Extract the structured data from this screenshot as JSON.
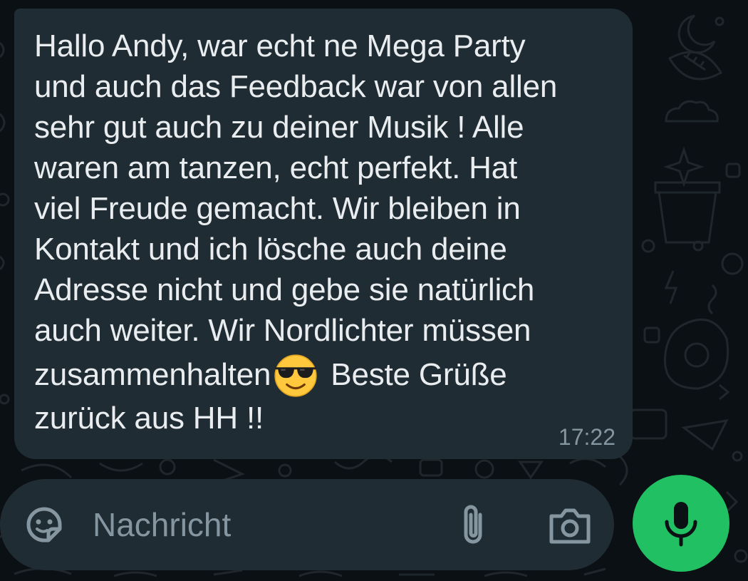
{
  "message": {
    "text_before_emoji": "Hallo Andy, war echt ne Mega Party\nund auch das Feedback war von allen\nsehr gut auch zu deiner Musik ! Alle\nwaren am tanzen, echt perfekt. Hat\nviel Freude gemacht. Wir bleiben in\nKontakt und ich lösche auch deine\nAdresse nicht und gebe sie natürlich\nauch weiter. Wir Nordlichter müssen\nzusammenhalten",
    "emoji": "smiling-face-with-sunglasses",
    "text_after_emoji": " Beste Grüße\nzurück aus HH !!",
    "time": "17:22"
  },
  "composer": {
    "placeholder": "Nachricht",
    "icons": [
      "sticker-icon",
      "paperclip-icon",
      "camera-icon"
    ]
  },
  "mic_button": {
    "icon": "microphone-icon",
    "color": "#21c063"
  },
  "colors": {
    "background": "#0b1014",
    "bubble": "#202c33",
    "text": "#e9edef",
    "muted": "#8696a0",
    "accent": "#21c063"
  }
}
